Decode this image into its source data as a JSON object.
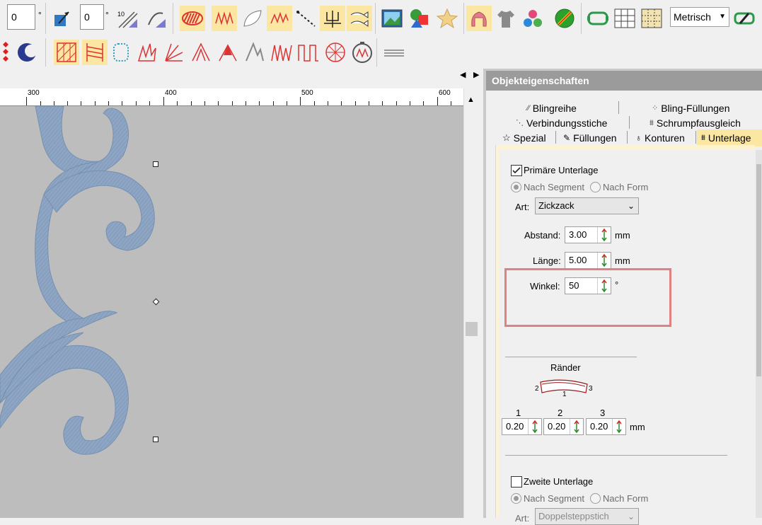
{
  "toolbar1": {
    "field_a_value": "0",
    "field_b_value": "0",
    "units_select": "Metrisch"
  },
  "ruler": {
    "labels": [
      "300",
      "400",
      "500",
      "600"
    ]
  },
  "panel": {
    "title": "Objekteigenschaften",
    "tabs_row1": [
      "Blingreihe",
      "Bling-Füllungen"
    ],
    "tabs_row2": [
      "Verbindungsstiche",
      "Schrumpfausgleich"
    ],
    "tabs_row3": [
      "Spezial",
      "Füllungen",
      "Konturen",
      "Unterlage"
    ],
    "active_tab": "Unterlage"
  },
  "primary": {
    "checkbox_label": "Primäre Unterlage",
    "checked": true,
    "radio_segment": "Nach Segment",
    "radio_form": "Nach Form",
    "art_label": "Art:",
    "art_value": "Zickzack",
    "abstand_label": "Abstand:",
    "abstand_value": "3.00",
    "laenge_label": "Länge:",
    "laenge_value": "5.00",
    "winkel_label": "Winkel:",
    "winkel_value": "50",
    "unit_mm": "mm",
    "unit_deg": "°"
  },
  "edges": {
    "title": "Ränder",
    "diagram_labels": [
      "2",
      "1",
      "3"
    ],
    "col_labels": [
      "1",
      "2",
      "3"
    ],
    "values": [
      "0.20",
      "0.20",
      "0.20"
    ],
    "unit": "mm"
  },
  "secondary": {
    "checkbox_label": "Zweite Unterlage",
    "checked": false,
    "radio_segment": "Nach Segment",
    "radio_form": "Nach Form",
    "art_label": "Art:",
    "art_value": "Doppelsteppstich"
  },
  "colors": {
    "highlight_box": "#e08080",
    "active_tab_bg": "#fbe6a2",
    "embroidery": "#8aa2c0",
    "canvas": "#bdbdbd"
  },
  "icons": [
    "stitch-direction-icon",
    "stitch-angle-icon",
    "satin-fill-icon",
    "zigzag-fill-icon",
    "leaf-shape-icon",
    "motif-fill-icon",
    "running-stitch-icon",
    "trident-icon",
    "fish-motif-icon",
    "picture-icon",
    "shapes-icon",
    "star-icon",
    "sweater-icon",
    "shirt-icon",
    "color-balls-icon",
    "no-entry-icon",
    "hoop-icon",
    "grid-icon",
    "grid-alt-icon",
    "pen-icon"
  ]
}
